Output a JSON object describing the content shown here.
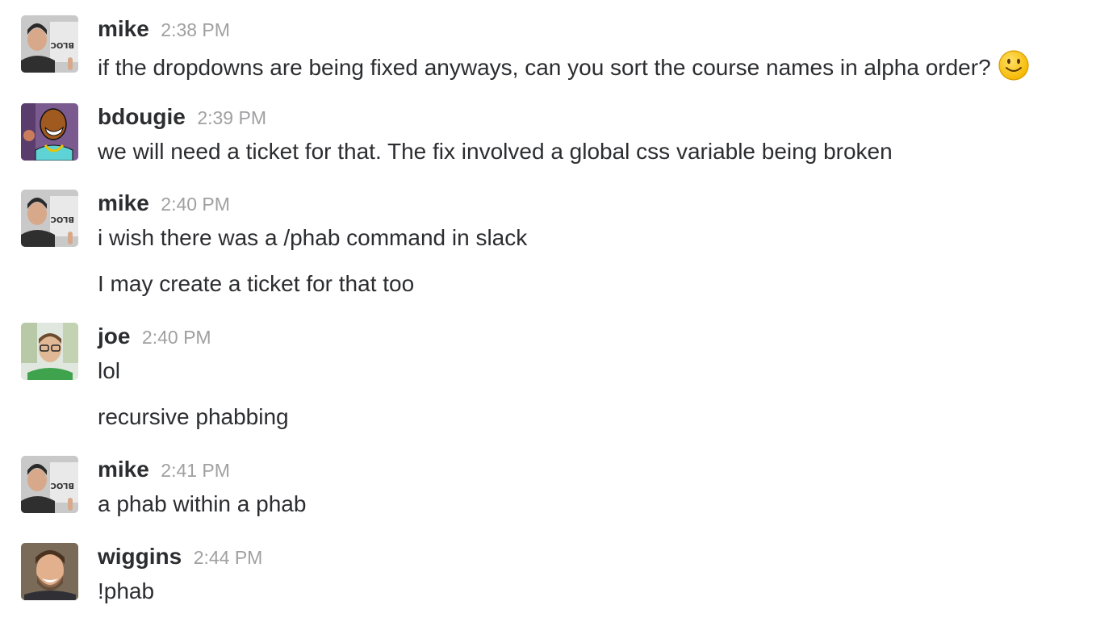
{
  "messages": [
    {
      "user": "mike",
      "time": "2:38 PM",
      "lines": [
        "if the dropdowns are being fixed anyways, can you sort the course names in alpha order?"
      ],
      "emoji": "slightly-smiling-face"
    },
    {
      "user": "bdougie",
      "time": "2:39 PM",
      "lines": [
        "we will need a ticket for that. The fix involved a global css variable being broken"
      ]
    },
    {
      "user": "mike",
      "time": "2:40 PM",
      "lines": [
        "i wish there was a /phab command in slack",
        "I may create a ticket for that too"
      ]
    },
    {
      "user": "joe",
      "time": "2:40 PM",
      "lines": [
        "lol",
        "recursive phabbing"
      ]
    },
    {
      "user": "mike",
      "time": "2:41 PM",
      "lines": [
        "a phab within a phab"
      ]
    },
    {
      "user": "wiggins",
      "time": "2:44 PM",
      "lines": [
        "!phab"
      ]
    }
  ],
  "colors": {
    "text": "#2c2d30",
    "timestamp": "#a0a0a2",
    "background": "#ffffff"
  }
}
